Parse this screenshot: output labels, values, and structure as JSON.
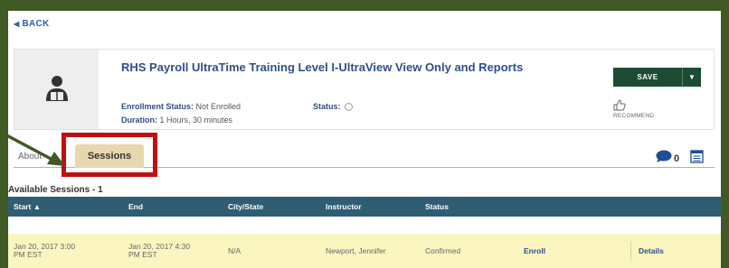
{
  "nav": {
    "back_label": "BACK"
  },
  "course": {
    "title": "RHS Payroll UltraTime Training Level I-UltraView View Only and Reports",
    "enrollment_status_label": "Enrollment Status:",
    "enrollment_status_value": "Not Enrolled",
    "duration_label": "Duration:",
    "duration_value": "1 Hours, 30 minutes",
    "status_label": "Status:",
    "thumbnail_icon": "person-reading-icon"
  },
  "actions": {
    "save_label": "SAVE",
    "recommend_label": "RECOMMEND"
  },
  "tabs": {
    "about_label": "About",
    "sessions_label": "Sessions"
  },
  "chat": {
    "count": "0"
  },
  "sessions": {
    "heading": "Available Sessions - 1",
    "columns": {
      "start": "Start ▲",
      "end": "End",
      "city": "City/State",
      "instructor": "Instructor",
      "status": "Status"
    },
    "rows": [
      {
        "start_line1": "Jan 20, 2017 3:00",
        "start_line2": "PM EST",
        "end_line1": "Jan 20, 2017 4:30",
        "end_line2": "PM EST",
        "city": "N/A",
        "instructor": "Newport, Jennifer",
        "status": "Confirmed",
        "enroll_label": "Enroll",
        "details_label": "Details"
      }
    ]
  },
  "colors": {
    "background": "#3f5a24",
    "accent_blue": "#2f4e8a",
    "save_green": "#1d4b33",
    "table_header": "#2f5d73",
    "row_highlight": "#fbf6c0",
    "callout_red": "#bf1010",
    "arrow": "#3f5a24"
  }
}
